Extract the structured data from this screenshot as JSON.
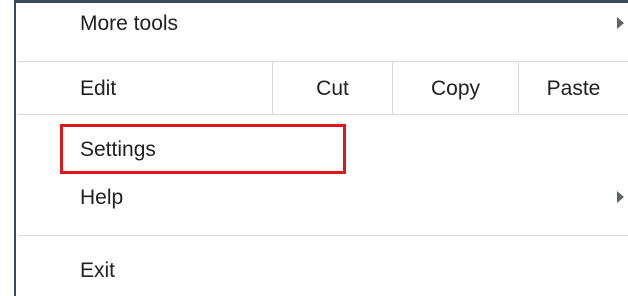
{
  "menu": {
    "more_tools": {
      "label": "More tools",
      "has_submenu": true
    },
    "edit": {
      "label": "Edit",
      "actions": [
        {
          "label": "Cut"
        },
        {
          "label": "Copy"
        },
        {
          "label": "Paste"
        }
      ]
    },
    "settings": {
      "label": "Settings",
      "highlighted": true
    },
    "help": {
      "label": "Help",
      "has_submenu": true
    },
    "exit": {
      "label": "Exit"
    }
  },
  "colors": {
    "highlight_border": "#e0161e",
    "separator": "#d8d8d8",
    "text": "#202124",
    "frame_border": "#3a4a5f"
  }
}
